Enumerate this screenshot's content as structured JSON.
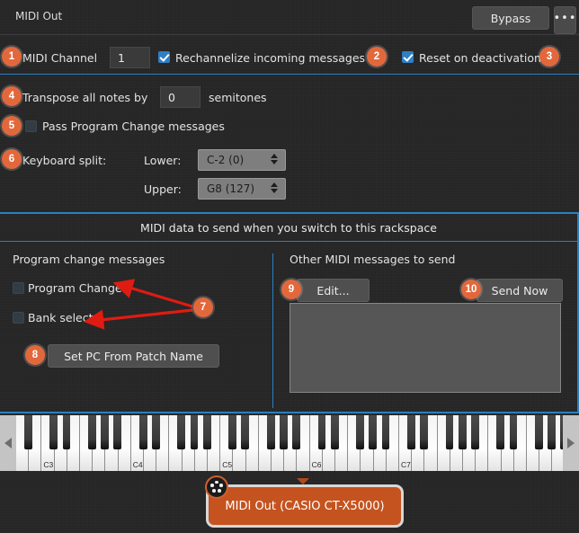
{
  "window": {
    "title": "MIDI Out",
    "bypass_label": "Bypass",
    "more_label": "•••"
  },
  "settings": {
    "midi_channel_label": "MIDI Channel",
    "midi_channel_value": "1",
    "rechannelize_label": "Rechannelize incoming messages",
    "rechannelize_checked": "checked",
    "reset_label": "Reset on deactivation",
    "reset_checked": "checked",
    "transpose_label": "Transpose all notes by",
    "transpose_value": "0",
    "semitones_label": "semitones",
    "pass_pc_label": "Pass Program Change messages",
    "pass_pc_checked": "unchecked",
    "keyboard_split_label": "Keyboard split:",
    "lower_label": "Lower:",
    "lower_value": "C-2 (0)",
    "upper_label": "Upper:",
    "upper_value": "G8 (127)"
  },
  "panel": {
    "heading": "MIDI data to send when you switch to this rackspace",
    "left": {
      "heading": "Program change messages",
      "program_change_label": "Program Change",
      "program_change_checked": "unchecked",
      "bank_select_label": "Bank select",
      "bank_select_checked": "unchecked",
      "set_pc_button": "Set PC From Patch Name"
    },
    "right": {
      "heading": "Other MIDI messages to send",
      "edit_button": "Edit...",
      "send_now_button": "Send Now",
      "messages_value": ""
    }
  },
  "keyboard": {
    "octave_labels": [
      "C3",
      "C4",
      "C5",
      "C6",
      "C7"
    ],
    "left_scroll": "◀",
    "right_scroll": "▶"
  },
  "footer": {
    "tag_label": "MIDI Out (CASIO CT-X5000)"
  },
  "badges": [
    {
      "n": "1"
    },
    {
      "n": "2"
    },
    {
      "n": "3"
    },
    {
      "n": "4"
    },
    {
      "n": "5"
    },
    {
      "n": "6"
    },
    {
      "n": "7"
    },
    {
      "n": "8"
    },
    {
      "n": "9"
    },
    {
      "n": "10"
    }
  ],
  "colors": {
    "badge": "#e2683c",
    "accent_divider": "#2b7fc0",
    "checkbox_on": "#2f7fc4",
    "arrow": "#e01b12",
    "tag": "#c4531f",
    "background": "#262626"
  }
}
